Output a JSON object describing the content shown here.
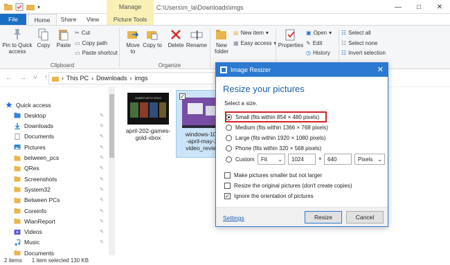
{
  "window": {
    "title_path": "C:\\Users\\m_la\\Downloads\\imgs",
    "contextual_tab": "Manage",
    "controls": [
      "—",
      "□",
      "✕"
    ]
  },
  "ribbon_tabs": [
    "File",
    "Home",
    "Share",
    "View",
    "Picture Tools"
  ],
  "ribbon": {
    "clipboard": {
      "pin": "Pin to Quick access",
      "copy": "Copy",
      "paste": "Paste",
      "cut": "Cut",
      "copy_path": "Copy path",
      "paste_shortcut": "Paste shortcut",
      "label": "Clipboard"
    },
    "organize": {
      "move_to": "Move to",
      "copy_to": "Copy to",
      "delete": "Delete",
      "rename": "Rename",
      "label": "Organize"
    },
    "new": {
      "new_folder": "New folder",
      "new_item": "New item",
      "easy_access": "Easy access"
    },
    "open": {
      "properties": "Properties",
      "open": "Open",
      "edit": "Edit",
      "history": "History"
    },
    "select": {
      "select_all": "Select all",
      "select_none": "Select none",
      "invert": "Invert selection"
    }
  },
  "address": {
    "crumbs": [
      "This PC",
      "Downloads",
      "imgs"
    ]
  },
  "sidebar": {
    "items": [
      {
        "label": "Quick access",
        "icon": "star-icon",
        "color": "#1a73e8",
        "pinned": false
      },
      {
        "label": "Desktop",
        "icon": "folder-icon",
        "color": "#2f86d8",
        "pinned": true
      },
      {
        "label": "Downloads",
        "icon": "download-icon",
        "color": "#2f86d8",
        "pinned": true
      },
      {
        "label": "Documents",
        "icon": "document-icon",
        "color": "#8a9bb0",
        "pinned": true
      },
      {
        "label": "Pictures",
        "icon": "pictures-icon",
        "color": "#2f86d8",
        "pinned": true
      },
      {
        "label": "between_pcs",
        "icon": "folder-icon",
        "color": "#e8b64c",
        "pinned": true
      },
      {
        "label": "QRes",
        "icon": "folder-icon",
        "color": "#e8b64c",
        "pinned": true
      },
      {
        "label": "Screenshots",
        "icon": "folder-icon",
        "color": "#e8b64c",
        "pinned": true
      },
      {
        "label": "System32",
        "icon": "folder-icon",
        "color": "#e8b64c",
        "pinned": true
      },
      {
        "label": "Between PCs",
        "icon": "folder-icon",
        "color": "#e8b64c",
        "pinned": true
      },
      {
        "label": "Coreinfo",
        "icon": "folder-icon",
        "color": "#e8b64c",
        "pinned": true
      },
      {
        "label": "WlanReport",
        "icon": "folder-icon",
        "color": "#e8b64c",
        "pinned": true
      },
      {
        "label": "Videos",
        "icon": "video-icon",
        "color": "#5a5ad0",
        "pinned": true
      },
      {
        "label": "Music",
        "icon": "music-icon",
        "color": "#2f86d8",
        "pinned": true
      },
      {
        "label": "Documents",
        "icon": "folder-icon",
        "color": "#e8b64c",
        "pinned": false
      }
    ]
  },
  "files": [
    {
      "name": "april-202-games-gold-xbox",
      "lines": [
        "april-202-games-",
        "gold-xbox"
      ],
      "thumb_text": "GAMES WITH GOLD"
    },
    {
      "name": "windows-10-2020-april-may-2020-video_review",
      "lines": [
        "windows-10-2",
        "-april-may-20",
        "video_review."
      ],
      "thumb_text": ""
    }
  ],
  "status": {
    "items": "2 items",
    "selected": "1 item selected  130 KB"
  },
  "dialog": {
    "title": "Image Resizer",
    "heading": "Resize your pictures",
    "select_label": "Select a size.",
    "options": [
      {
        "label": "Small (fits within 854 × 480 pixels)",
        "selected": true
      },
      {
        "label": "Medium (fits within 1366 × 768 pixels)",
        "selected": false
      },
      {
        "label": "Large (fits within 1920 × 1080 pixels)",
        "selected": false
      },
      {
        "label": "Phone (fits within 320 × 568 pixels)",
        "selected": false
      }
    ],
    "custom": {
      "label": "Custom",
      "mode": "Fit",
      "width": "1024",
      "height": "640",
      "unit": "Pixels",
      "sep": "×"
    },
    "checks": [
      {
        "label": "Make pictures smaller but not larger",
        "checked": false
      },
      {
        "label": "Resize the original pictures (don't create copies)",
        "checked": false
      },
      {
        "label": "Ignore the orientation of pictures",
        "checked": true
      }
    ],
    "settings_link": "Settings",
    "resize_button": "Resize",
    "cancel_button": "Cancel",
    "close": "✕"
  }
}
